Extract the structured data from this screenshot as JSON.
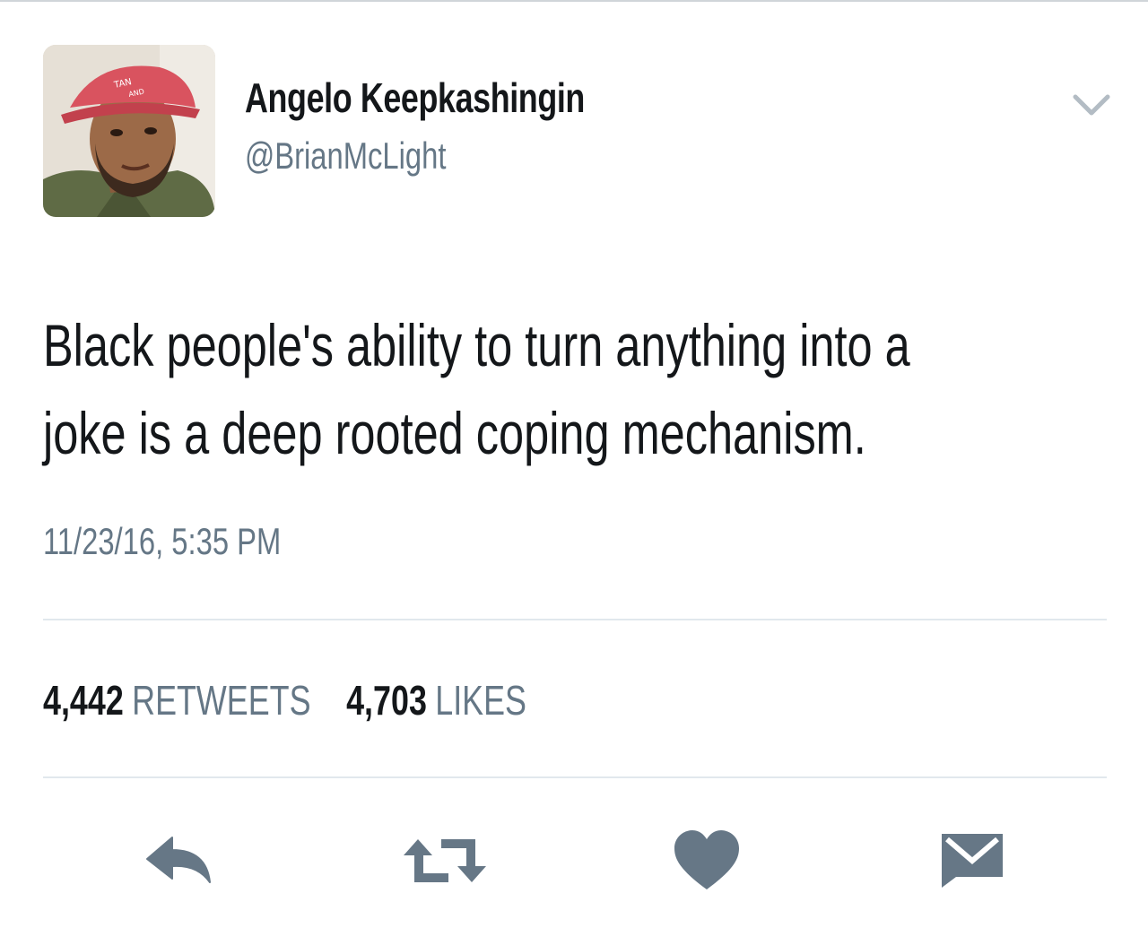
{
  "tweet": {
    "author": {
      "name": "Angelo Keepkashingin",
      "handle": "@BrianMcLight"
    },
    "text_lines": [
      "Black people's ability to turn anything into a",
      "joke is a deep rooted coping mechanism."
    ],
    "timestamp": "11/23/16, 5:35 PM",
    "stats": {
      "retweets_count": "4,442",
      "retweets_label": "RETWEETS",
      "likes_count": "4,703",
      "likes_label": "LIKES"
    },
    "actions": [
      {
        "name": "reply",
        "icon": "reply-icon"
      },
      {
        "name": "retweet",
        "icon": "retweet-icon"
      },
      {
        "name": "like",
        "icon": "heart-icon"
      },
      {
        "name": "direct-message",
        "icon": "envelope-icon"
      }
    ]
  },
  "colors": {
    "text_primary": "#14171a",
    "text_secondary": "#657786",
    "icon_gray": "#667786",
    "divider": "#e1e8ed"
  }
}
